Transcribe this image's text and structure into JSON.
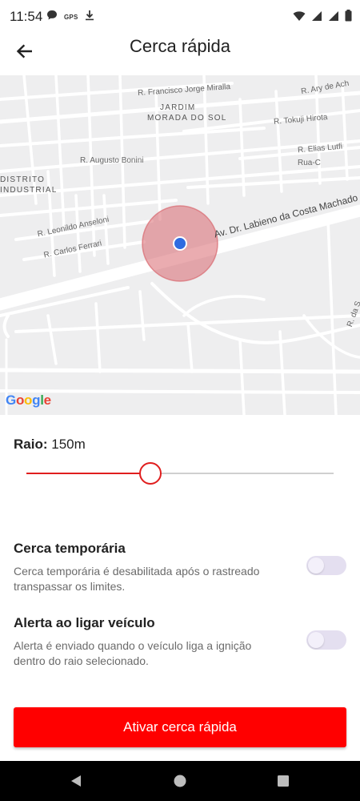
{
  "status_bar": {
    "time": "11:54",
    "gps_text": "GPS",
    "left_icons": [
      "chat-icon",
      "gps-icon",
      "download-icon"
    ],
    "right_icons": [
      "wifi-icon",
      "signal-icon",
      "signal-icon",
      "battery-icon"
    ]
  },
  "app_bar": {
    "title": "Cerca rápida",
    "back_icon": "arrow-left-icon"
  },
  "map": {
    "streets": {
      "ary": "R. Ary de Ach",
      "francisco": "R. Francisco Jorge Miralla",
      "tokuji": "R. Tokuji Hirota",
      "elias": "R. Elias Lutfi",
      "ruac": "Rua-C",
      "augusto": "R. Augusto Bonini",
      "leonildo": "R. Leonildo Anseloni",
      "carlos": "R. Carlos Ferrari",
      "labieno": "Av. Dr. Labieno da Costa Machado",
      "rda": "R. da S"
    },
    "district_jardim": "JARDIM",
    "district_morada": "MORADA DO SOL",
    "district_distrito": "DISTRITO",
    "district_industrial": "INDUSTRIAL",
    "provider": [
      "G",
      "o",
      "o",
      "g",
      "l",
      "e"
    ],
    "geofence_color": "#d9686f",
    "marker_color": "#2f6be0"
  },
  "radius": {
    "label": "Raio:",
    "value": "150m",
    "slider_fraction": 0.401
  },
  "options": {
    "temporary": {
      "title": "Cerca temporária",
      "description": "Cerca temporária é desabilitada após o rastreado transpassar os limites.",
      "enabled": false
    },
    "ignition_alert": {
      "title": "Alerta ao ligar veículo",
      "description": "Alerta é enviado quando o veículo liga a ignição dentro do raio selecionado.",
      "enabled": false
    }
  },
  "actions": {
    "activate_label": "Ativar cerca rápida"
  },
  "nav_bar": {
    "icons": [
      "back-triangle-icon",
      "home-circle-icon",
      "recents-square-icon"
    ]
  },
  "colors": {
    "accent": "#ff0000",
    "slider_accent": "#e01e1e",
    "toggle_off": "#e4dff0"
  }
}
